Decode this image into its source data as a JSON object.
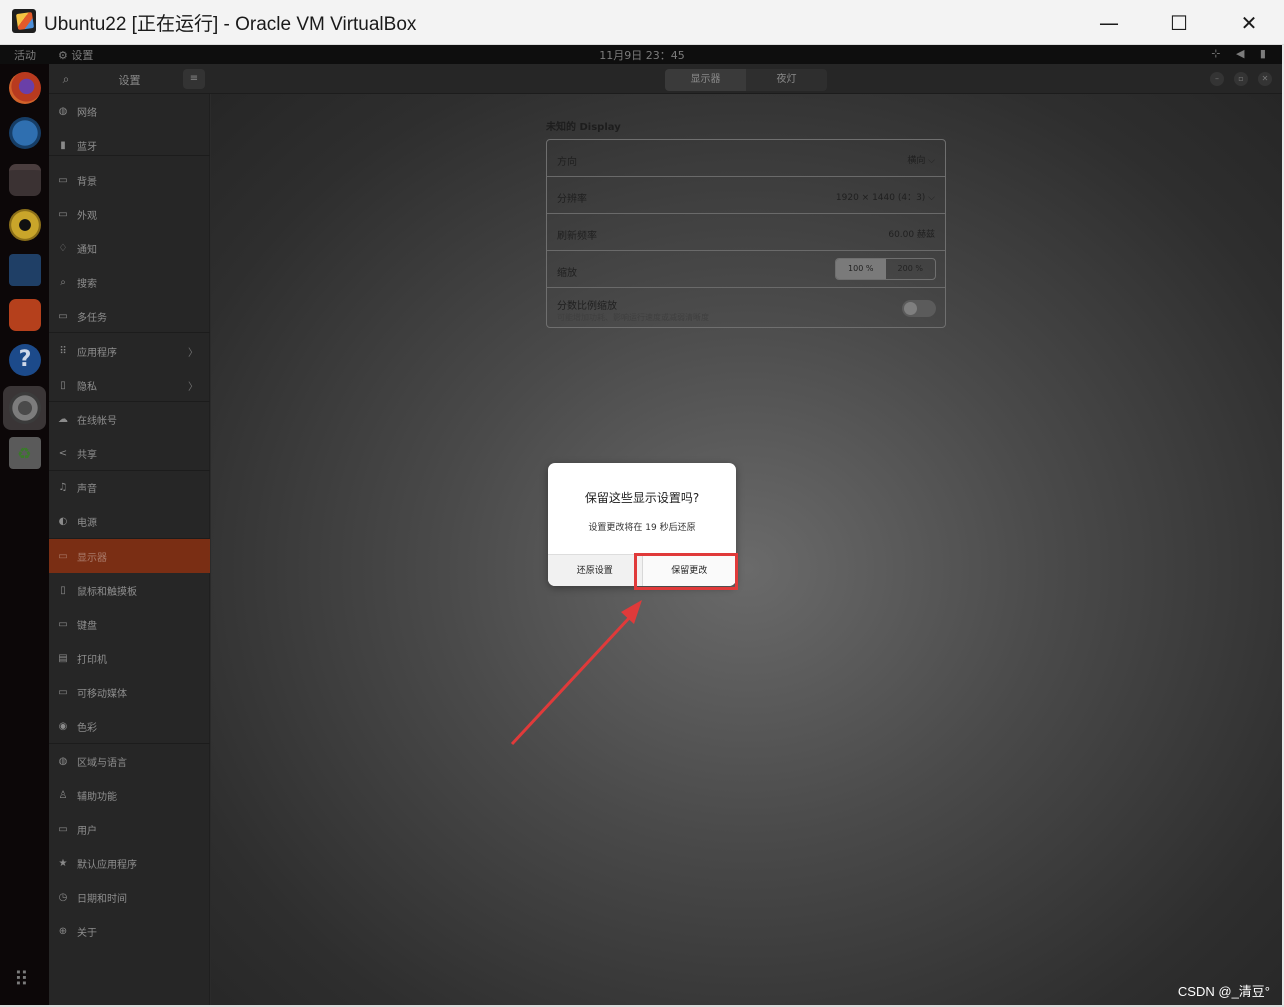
{
  "host_window": {
    "title": "Ubuntu22 [正在运行] - Oracle VM VirtualBox",
    "minimize": "—",
    "maximize": "☐",
    "close": "✕"
  },
  "topbar": {
    "activities": "活动",
    "app_menu": "⚙ 设置",
    "clock": "11月9日 23：45",
    "tray": "⊹ ◀ ▮"
  },
  "dock": {
    "items": [
      "firefox-icon",
      "thunderbird-icon",
      "files-icon",
      "rhythmbox-icon",
      "writer-icon",
      "app-center-icon",
      "help-icon",
      "settings-icon",
      "trash-icon"
    ],
    "help_glyph": "?",
    "grid_glyph": "⠿"
  },
  "settings": {
    "search_glyph": "⌕",
    "title": "设置",
    "menu_glyph": "≡",
    "tabs": [
      "显示器",
      "夜灯"
    ],
    "win_btns": [
      "–",
      "▫",
      "✕"
    ],
    "sidebar": [
      {
        "label": "网络",
        "icon": "◍"
      },
      {
        "label": "蓝牙",
        "icon": "▮"
      },
      {
        "label": "背景",
        "icon": "▭"
      },
      {
        "label": "外观",
        "icon": "▭"
      },
      {
        "label": "通知",
        "icon": "♢"
      },
      {
        "label": "搜索",
        "icon": "⌕"
      },
      {
        "label": "多任务",
        "icon": "▭"
      },
      {
        "label": "应用程序",
        "icon": "⠿",
        "chevron": "〉"
      },
      {
        "label": "隐私",
        "icon": "▯",
        "chevron": "〉"
      },
      {
        "label": "在线帐号",
        "icon": "☁"
      },
      {
        "label": "共享",
        "icon": "<"
      },
      {
        "label": "声音",
        "icon": "♫"
      },
      {
        "label": "电源",
        "icon": "◐"
      },
      {
        "label": "显示器",
        "icon": "▭"
      },
      {
        "label": "鼠标和触摸板",
        "icon": "▯"
      },
      {
        "label": "键盘",
        "icon": "▭"
      },
      {
        "label": "打印机",
        "icon": "▤"
      },
      {
        "label": "可移动媒体",
        "icon": "▭"
      },
      {
        "label": "色彩",
        "icon": "◉"
      },
      {
        "label": "区域与语言",
        "icon": "◍"
      },
      {
        "label": "辅助功能",
        "icon": "♙"
      },
      {
        "label": "用户",
        "icon": "▭"
      },
      {
        "label": "默认应用程序",
        "icon": "★"
      },
      {
        "label": "日期和时间",
        "icon": "◷"
      },
      {
        "label": "关于",
        "icon": "⊕"
      }
    ],
    "active_item": "显示器"
  },
  "display": {
    "section_label": "未知的 Display",
    "rows": {
      "orientation": {
        "label": "方向",
        "value": "横向 ⌵"
      },
      "resolution": {
        "label": "分辨率",
        "value": "1920 × 1440 (4：3) ⌵"
      },
      "refresh": {
        "label": "刷新频率",
        "value": "60.00 赫兹"
      },
      "scale": {
        "label": "缩放",
        "options": [
          "100 %",
          "200 %"
        ],
        "selected": "100 %"
      },
      "fractional": {
        "label": "分数比例缩放",
        "sub": "可能增加功耗、影响运行速度或减弱清晰度",
        "enabled": false
      }
    }
  },
  "dialog": {
    "title": "保留这些显示设置吗?",
    "body": "设置更改将在 19 秒后还原",
    "revert": "还原设置",
    "keep": "保留更改"
  },
  "annotation_color": "#e03a3a",
  "watermark": "CSDN @_清豆°"
}
